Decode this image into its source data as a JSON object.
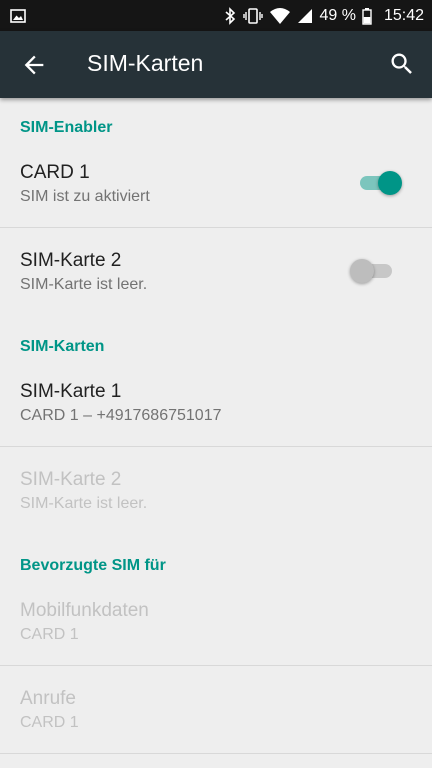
{
  "status_bar": {
    "battery": "49 %",
    "time": "15:42",
    "icons": [
      "gallery-icon",
      "bluetooth-icon",
      "vibrate-icon",
      "wifi-icon",
      "signal-icon",
      "battery-icon"
    ]
  },
  "toolbar": {
    "title": "SIM-Karten",
    "back_icon": "arrow-back-icon",
    "search_icon": "search-icon"
  },
  "sections": {
    "enabler_header": "SIM-Enabler",
    "cards_header": "SIM-Karten",
    "preferred_header": "Bevorzugte SIM für"
  },
  "enabler": [
    {
      "title": "CARD 1",
      "subtitle": "SIM ist zu aktiviert",
      "enabled": true
    },
    {
      "title": "SIM-Karte 2",
      "subtitle": "SIM-Karte ist leer.",
      "enabled": false
    }
  ],
  "cards": [
    {
      "title": "SIM-Karte 1",
      "subtitle": "CARD 1 – +4917686751017",
      "disabled": false
    },
    {
      "title": "SIM-Karte 2",
      "subtitle": "SIM-Karte ist leer.",
      "disabled": true
    }
  ],
  "preferred": [
    {
      "title": "Mobilfunkdaten",
      "subtitle": "CARD 1",
      "disabled": true
    },
    {
      "title": "Anrufe",
      "subtitle": "CARD 1",
      "disabled": true
    }
  ],
  "colors": {
    "accent": "#009587",
    "toolbar": "#263238",
    "status_bar": "#151515",
    "background": "#eeeeee"
  }
}
